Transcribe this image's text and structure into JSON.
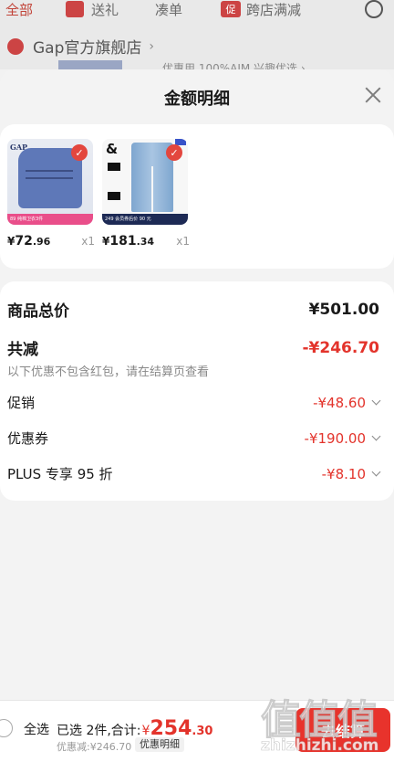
{
  "background": {
    "tabs": [
      "全部",
      "送礼",
      "凑单",
      "跨店满减"
    ],
    "promo_icon_text": "促",
    "shop_name": "Gap官方旗舰店",
    "shop_chevron": "›",
    "partial_line": "优惠用 100%AIM 兴趣优选 ›"
  },
  "modal": {
    "title": "金额明细",
    "products": [
      {
        "brand_text": "GAP",
        "strip_text": "89  纯棉卫衣3件",
        "price_symbol": "¥",
        "price_int": "72",
        "price_cents": ".96",
        "qty": "x1"
      },
      {
        "brand_text": "&",
        "strip_text": "249  会员券后价 90 元",
        "price_symbol": "¥",
        "price_int": "181",
        "price_cents": ".34",
        "qty": "x1"
      }
    ],
    "summary": {
      "total_label": "商品总价",
      "total_value": "¥501.00",
      "reduce_label": "共减",
      "reduce_value": "-¥246.70",
      "note": "以下优惠不包含红包，请在结算页查看",
      "items": [
        {
          "label": "促销",
          "value": "-¥48.60"
        },
        {
          "label": "优惠券",
          "value": "-¥190.00"
        },
        {
          "label": "PLUS 专享 95 折",
          "value": "-¥8.10"
        }
      ]
    }
  },
  "bottom_bar": {
    "select_all": "全选",
    "selected_prefix": "已选 2件,合计:",
    "total_symbol": "¥",
    "total_int": "254",
    "total_cents": ".30",
    "discount_text": "优惠减:¥246.70",
    "detail_button": "优惠明细",
    "checkout_button": "去结算"
  },
  "watermark": {
    "top": "值值值",
    "bottom": "zhizhizhi.com"
  },
  "colors": {
    "accent_red": "#e3332b",
    "badge_red": "#e3463e"
  }
}
